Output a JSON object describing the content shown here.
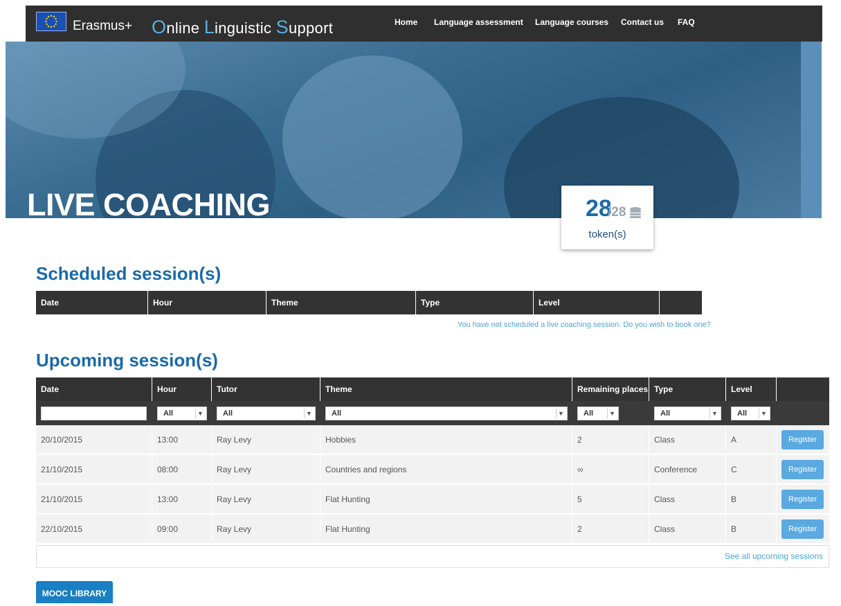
{
  "header": {
    "brand": "Erasmus+",
    "title_parts": [
      {
        "cap": "O",
        "rest": "nline "
      },
      {
        "cap": "L",
        "rest": "inguistic "
      },
      {
        "cap": "S",
        "rest": "upport"
      }
    ],
    "nav": [
      "Home",
      "Language assessment",
      "Language courses",
      "Contact us",
      "FAQ"
    ]
  },
  "hero": {
    "title": "LIVE COACHING"
  },
  "tokens": {
    "available": "28",
    "total": "/28",
    "label": "token(s)"
  },
  "scheduled": {
    "heading": "Scheduled session(s)",
    "columns": [
      "Date",
      "Hour",
      "Theme",
      "Type",
      "Level",
      ""
    ],
    "empty_message": "You have not scheduled a live coaching session. Do you wish to book one?"
  },
  "upcoming": {
    "heading": "Upcoming session(s)",
    "columns": [
      "Date",
      "Hour",
      "Tutor",
      "Theme",
      "Remaining places",
      "Type",
      "Level",
      ""
    ],
    "filters": {
      "date": "",
      "hour": "All",
      "tutor": "All",
      "theme": "All",
      "places": "All",
      "type": "All",
      "level": "All"
    },
    "rows": [
      {
        "date": "20/10/2015",
        "hour": "13:00",
        "tutor": "Ray Levy",
        "theme": "Hobbies",
        "places": "2",
        "type": "Class",
        "level": "A",
        "action": "Register"
      },
      {
        "date": "21/10/2015",
        "hour": "08:00",
        "tutor": "Ray Levy",
        "theme": "Countries and regions",
        "places": "∞",
        "type": "Conference",
        "level": "C",
        "action": "Register"
      },
      {
        "date": "21/10/2015",
        "hour": "13:00",
        "tutor": "Ray Levy",
        "theme": "Flat Hunting",
        "places": "5",
        "type": "Class",
        "level": "B",
        "action": "Register"
      },
      {
        "date": "22/10/2015",
        "hour": "09:00",
        "tutor": "Ray Levy",
        "theme": "Flat Hunting",
        "places": "2",
        "type": "Class",
        "level": "B",
        "action": "Register"
      }
    ],
    "see_all": "See all upcoming sessions"
  },
  "mooc_button": "MOOC LIBRARY",
  "colors": {
    "accent": "#1a6aa8",
    "nav_bg": "#2f2f2f",
    "table_header": "#333333",
    "register": "#5aa9e0"
  }
}
